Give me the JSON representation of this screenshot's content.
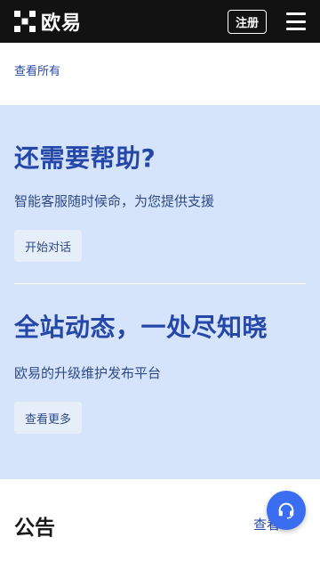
{
  "header": {
    "logo_text": "欧易",
    "register_label": "注册",
    "menu_icon": "hamburger-menu-icon",
    "background": "#121212"
  },
  "top_link": {
    "label": "查看所有"
  },
  "help_section": {
    "background": "#d6e4fb",
    "accent": "#2548a8",
    "support_title": "还需要帮助?",
    "support_desc": "智能客服随时候命，为您提供支援",
    "support_button": "开始对话",
    "news_title": "全站动态，一处尽知晓",
    "news_desc": "欧易的升级维护发布平台",
    "news_button": "查看更多"
  },
  "announcements": {
    "title": "公告",
    "more_label": "查看"
  },
  "support_fab": {
    "icon": "headset-icon",
    "color": "#3b6df0"
  }
}
